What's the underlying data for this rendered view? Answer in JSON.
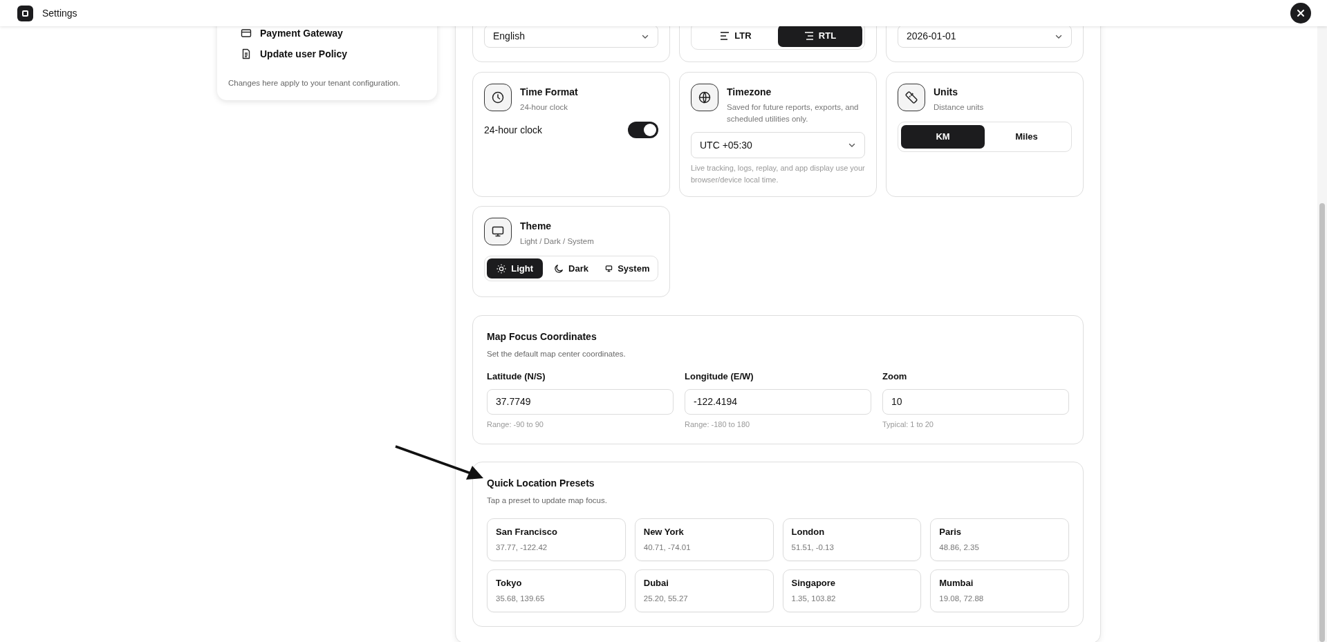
{
  "header": {
    "title": "Settings"
  },
  "sidebar": {
    "items": [
      {
        "label": "Payment Gateway"
      },
      {
        "label": "Update user Policy"
      }
    ],
    "note": "Changes here apply to your tenant configuration."
  },
  "top_row": {
    "language": {
      "value": "English"
    },
    "direction": {
      "options": [
        {
          "label": "LTR",
          "selected": false
        },
        {
          "label": "RTL",
          "selected": true
        }
      ]
    },
    "date": {
      "value": "2026-01-01"
    }
  },
  "time_format": {
    "title": "Time Format",
    "subtitle": "24-hour clock",
    "toggle": {
      "label": "24-hour clock",
      "on": true
    }
  },
  "timezone": {
    "title": "Timezone",
    "subtitle": "Saved for future reports, exports, and scheduled utilities only.",
    "value": "UTC +05:30",
    "note": "Live tracking, logs, replay, and app display use your browser/device local time."
  },
  "units": {
    "title": "Units",
    "subtitle": "Distance units",
    "options": [
      {
        "label": "KM",
        "selected": true
      },
      {
        "label": "Miles",
        "selected": false
      }
    ]
  },
  "theme": {
    "title": "Theme",
    "subtitle": "Light / Dark / System",
    "options": [
      {
        "label": "Light",
        "selected": true
      },
      {
        "label": "Dark",
        "selected": false
      },
      {
        "label": "System",
        "selected": false
      }
    ]
  },
  "map_focus": {
    "title": "Map Focus Coordinates",
    "subtitle": "Set the default map center coordinates.",
    "fields": [
      {
        "label": "Latitude (N/S)",
        "value": "37.7749",
        "hint": "Range: -90 to 90"
      },
      {
        "label": "Longitude (E/W)",
        "value": "-122.4194",
        "hint": "Range: -180 to 180"
      },
      {
        "label": "Zoom",
        "value": "10",
        "hint": "Typical: 1 to 20"
      }
    ]
  },
  "presets": {
    "title": "Quick Location Presets",
    "subtitle": "Tap a preset to update map focus.",
    "items": [
      {
        "name": "San Francisco",
        "coords": "37.77, -122.42"
      },
      {
        "name": "New York",
        "coords": "40.71, -74.01"
      },
      {
        "name": "London",
        "coords": "51.51, -0.13"
      },
      {
        "name": "Paris",
        "coords": "48.86, 2.35"
      },
      {
        "name": "Tokyo",
        "coords": "35.68, 139.65"
      },
      {
        "name": "Dubai",
        "coords": "25.20, 55.27"
      },
      {
        "name": "Singapore",
        "coords": "1.35, 103.82"
      },
      {
        "name": "Mumbai",
        "coords": "19.08, 72.88"
      }
    ]
  }
}
